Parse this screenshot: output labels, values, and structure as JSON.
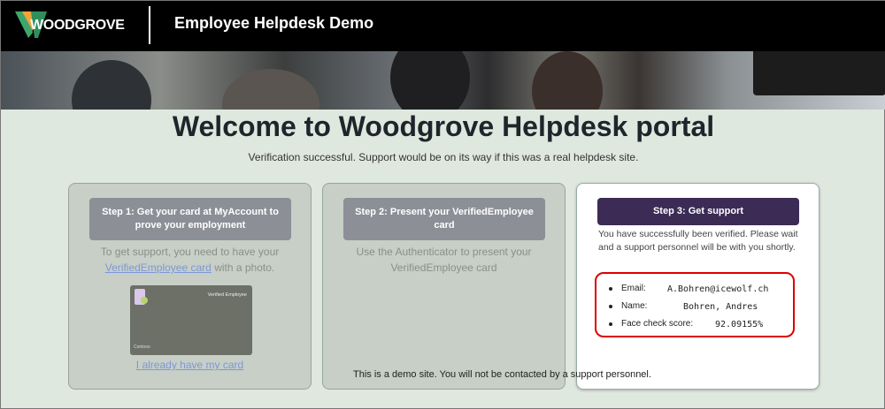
{
  "header": {
    "logo_text": "WOODGROVE",
    "app_title": "Employee Helpdesk Demo"
  },
  "main": {
    "welcome_title": "Welcome to Woodgrove Helpdesk portal",
    "status_text": "Verification successful. Support would be on its way if this was a real helpdesk site."
  },
  "steps": [
    {
      "button_label": "Step 1: Get your card at MyAccount to prove your employment",
      "text_before": "To get support, you need to have your",
      "link_text": "VerifiedEmployee card",
      "text_after": "with a photo.",
      "card_title": "Verified Employee",
      "card_issuer": "Contoso",
      "have_card_link": "I already have my card"
    },
    {
      "button_label": "Step 2: Present your VerifiedEmployee card",
      "text": "Use the Authenticator to present your VerifiedEmployee card"
    },
    {
      "button_label": "Step 3: Get support",
      "text": "You have successfully been verified. Please wait and a support personnel will be with you shortly.",
      "results": [
        {
          "label": "Email:",
          "value": "A.Bohren@icewolf.ch"
        },
        {
          "label": "Name:",
          "value": "Bohren, Andres"
        },
        {
          "label": "Face check score:",
          "value": "92.09155%"
        }
      ]
    }
  ],
  "footer_note": "This is a demo site. You will not be contacted by a support personnel.",
  "colors": {
    "topbar": "#000000",
    "background": "#dfe8df",
    "active_button": "#3b2b55",
    "disabled_button": "#8d8f97",
    "highlight_border": "#dd0000"
  }
}
